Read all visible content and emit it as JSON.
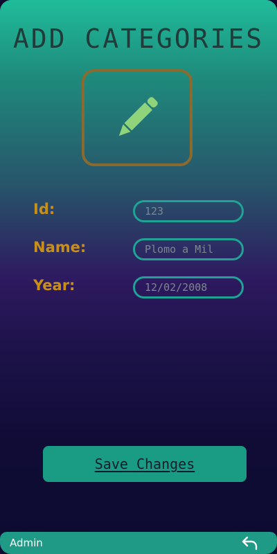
{
  "page": {
    "title": "ADD CATEGORIES"
  },
  "icon": {
    "name": "pencil-icon",
    "color": "#8fd47a",
    "frame_color": "#8a6a2e"
  },
  "form": {
    "fields": [
      {
        "label": "Id:",
        "placeholder": "123"
      },
      {
        "label": "Name:",
        "placeholder": "Plomo a Mil"
      },
      {
        "label": "Year:",
        "placeholder": "12/02/2008"
      }
    ]
  },
  "actions": {
    "save_label": "Save Changes"
  },
  "bottom_bar": {
    "user_label": "Admin",
    "back_icon": "back-arrow-icon"
  },
  "colors": {
    "accent": "#1fa394",
    "label": "#c8901a",
    "button": "#1a9c84"
  }
}
